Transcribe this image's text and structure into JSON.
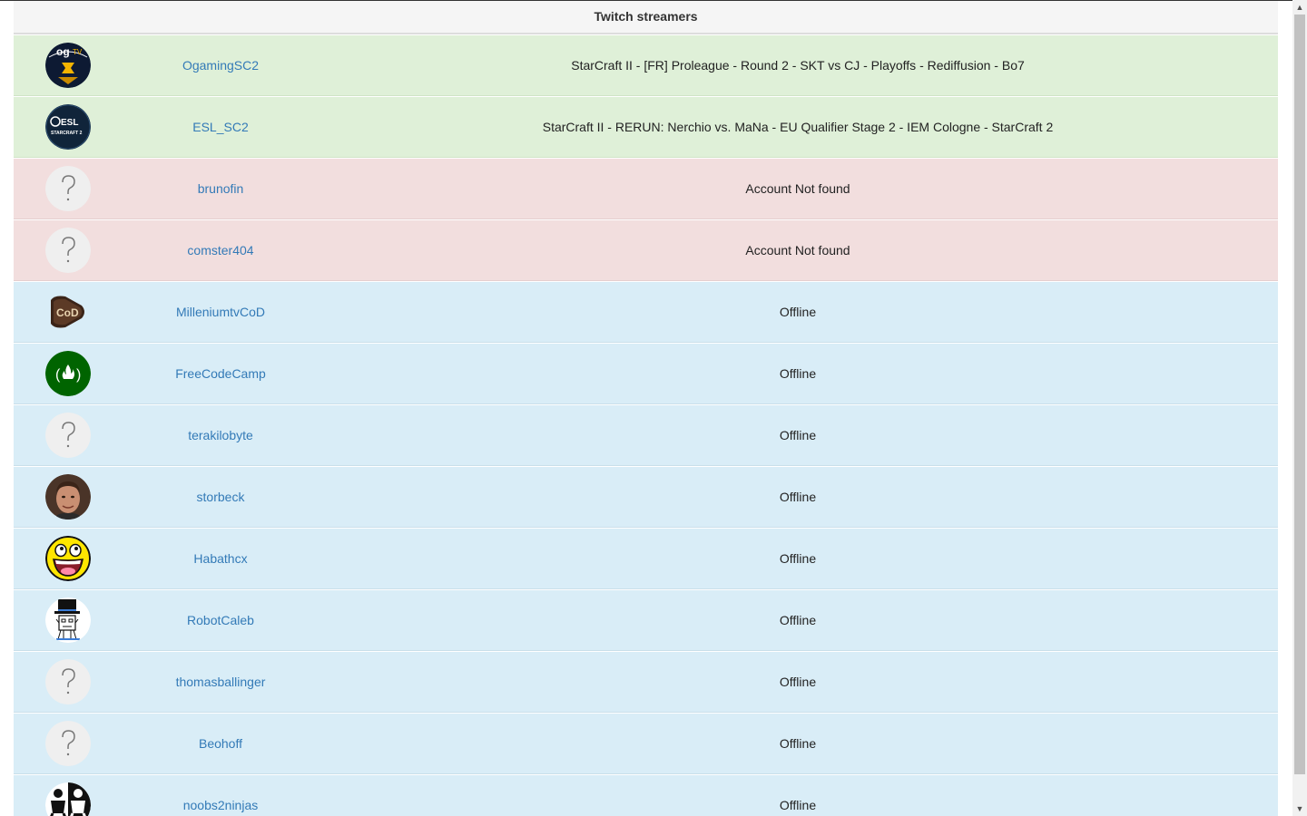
{
  "table": {
    "title": "Twitch streamers"
  },
  "streamers": [
    {
      "name": "OgamingSC2",
      "status": "StarCraft II - [FR] Proleague - Round 2 - SKT vs CJ - Playoffs - Rediffusion - Bo7",
      "state": "online",
      "avatar": "ogamingsc2-logo-icon"
    },
    {
      "name": "ESL_SC2",
      "status": "StarCraft II - RERUN: Nerchio vs. MaNa - EU Qualifier Stage 2 - IEM Cologne - StarCraft 2",
      "state": "online",
      "avatar": "esl-starcraft2-logo-icon"
    },
    {
      "name": "brunofin",
      "status": "Account Not found",
      "state": "notfound",
      "avatar": "question-mark-icon"
    },
    {
      "name": "comster404",
      "status": "Account Not found",
      "state": "notfound",
      "avatar": "question-mark-icon"
    },
    {
      "name": "MilleniumtvCoD",
      "status": "Offline",
      "state": "offline",
      "avatar": "cod-logo-icon"
    },
    {
      "name": "FreeCodeCamp",
      "status": "Offline",
      "state": "offline",
      "avatar": "freecodecamp-logo-icon"
    },
    {
      "name": "terakilobyte",
      "status": "Offline",
      "state": "offline",
      "avatar": "question-mark-icon"
    },
    {
      "name": "storbeck",
      "status": "Offline",
      "state": "offline",
      "avatar": "user-photo-icon"
    },
    {
      "name": "Habathcx",
      "status": "Offline",
      "state": "offline",
      "avatar": "awesome-face-icon"
    },
    {
      "name": "RobotCaleb",
      "status": "Offline",
      "state": "offline",
      "avatar": "top-hat-robot-icon"
    },
    {
      "name": "thomasballinger",
      "status": "Offline",
      "state": "offline",
      "avatar": "question-mark-icon"
    },
    {
      "name": "Beohoff",
      "status": "Offline",
      "state": "offline",
      "avatar": "question-mark-icon"
    },
    {
      "name": "noobs2ninjas",
      "status": "Offline",
      "state": "offline",
      "avatar": "ninja-logo-icon"
    }
  ],
  "colors": {
    "online": "#dff0d8",
    "notfound": "#f2dede",
    "offline": "#d9edf7",
    "link": "#337ab7"
  }
}
